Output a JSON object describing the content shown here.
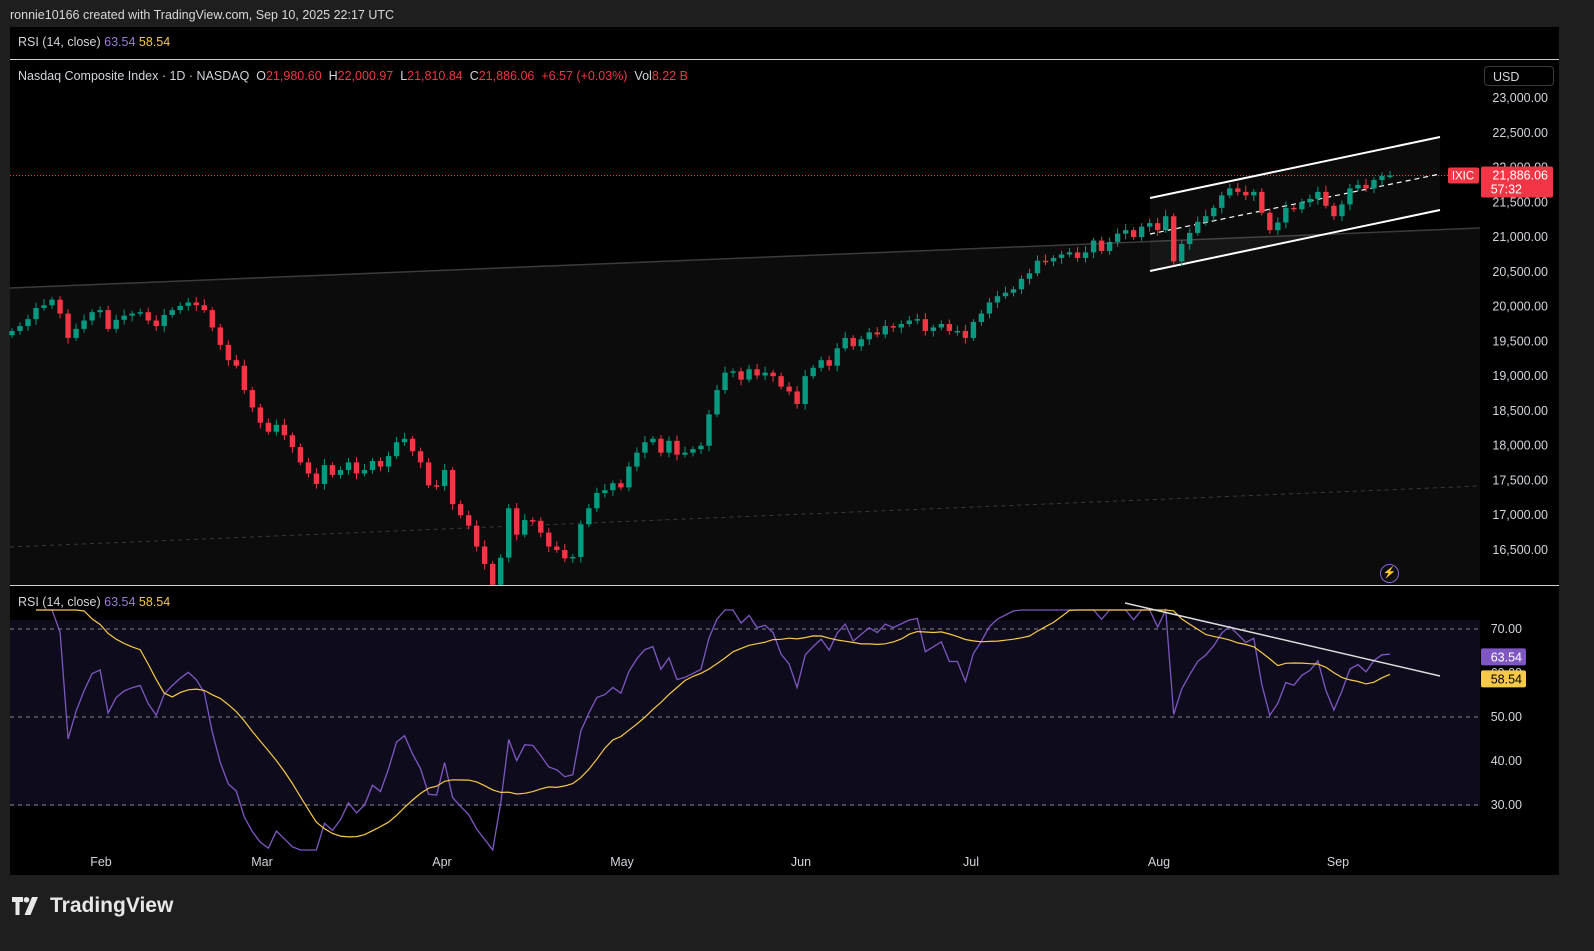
{
  "credit": "ronnie10166 created with TradingView.com, Sep 10, 2025 22:17 UTC",
  "top_indicator": {
    "label": "RSI (14, close)",
    "v1": "63.54",
    "v2": "58.54"
  },
  "header": {
    "symbol": "Nasdaq Composite Index · 1D · NASDAQ",
    "o_label": "O",
    "o": "21,980.60",
    "h_label": "H",
    "h": "22,000.97",
    "l_label": "L",
    "l": "21,810.84",
    "c_label": "C",
    "c": "21,886.06",
    "change": "+6.57 (+0.03%)",
    "vol_label": "Vol",
    "vol": "8.22 B"
  },
  "currency": "USD",
  "brand": "TradingView",
  "colors": {
    "up": "#089981",
    "down": "#f23645",
    "rsi": "#7e57c2",
    "rsi_ma": "#f7c948",
    "bg": "#000000"
  },
  "chart_data": [
    {
      "type": "candlestick",
      "title": "Nasdaq Composite Index · 1D · NASDAQ",
      "x_ticks": [
        "Feb",
        "Mar",
        "Apr",
        "May",
        "Jun",
        "Jul",
        "Aug",
        "Sep"
      ],
      "y_ticks": [
        "23,000.00",
        "22,500.00",
        "22,000.00",
        "21,500.00",
        "21,000.00",
        "20,500.00",
        "20,000.00",
        "19,500.00",
        "19,000.00",
        "18,500.00",
        "18,000.00",
        "17,500.00",
        "17,000.00",
        "16,500.00"
      ],
      "ylim": [
        16050,
        23250
      ],
      "last_price": {
        "symbol": "IXIC",
        "value": "21,886.06",
        "countdown": "57:32"
      },
      "closes": [
        19650,
        19720,
        19820,
        19980,
        20020,
        20100,
        19900,
        19550,
        19680,
        19800,
        19920,
        19950,
        19680,
        19810,
        19870,
        19900,
        19920,
        19800,
        19720,
        19880,
        19950,
        20010,
        20060,
        20020,
        19950,
        19700,
        19450,
        19230,
        19150,
        18800,
        18550,
        18330,
        18200,
        18300,
        18150,
        17980,
        17760,
        17600,
        17450,
        17720,
        17580,
        17650,
        17760,
        17600,
        17650,
        17780,
        17700,
        17850,
        18050,
        18100,
        17920,
        17760,
        17430,
        17420,
        17650,
        17160,
        17000,
        16850,
        16550,
        16300,
        16000,
        16390,
        17100,
        16720,
        16930,
        16920,
        16750,
        16550,
        16500,
        16380,
        16400,
        16870,
        17100,
        17320,
        17360,
        17460,
        17400,
        17700,
        17900,
        18050,
        18100,
        17900,
        18070,
        17870,
        17900,
        17950,
        18000,
        18450,
        18800,
        19050,
        19070,
        18950,
        19100,
        19010,
        19050,
        19000,
        18850,
        18780,
        18600,
        19000,
        19120,
        19230,
        19150,
        19400,
        19550,
        19430,
        19530,
        19630,
        19600,
        19720,
        19700,
        19750,
        19800,
        19820,
        19650,
        19700,
        19750,
        19650,
        19650,
        19550,
        19780,
        19900,
        20060,
        20150,
        20200,
        20250,
        20400,
        20480,
        20660,
        20650,
        20700,
        20750,
        20780,
        20700,
        20780,
        20950,
        20800,
        20930,
        21050,
        21100,
        21000,
        21150,
        21200,
        21100,
        21300,
        20650,
        20900,
        21060,
        21220,
        21300,
        21420,
        21600,
        21700,
        21650,
        21600,
        21650,
        21350,
        21100,
        21210,
        21420,
        21400,
        21500,
        21550,
        21650,
        21450,
        21300,
        21470,
        21700,
        21750,
        21700,
        21820,
        21880,
        21886
      ],
      "rsi": {
        "title": "RSI (14, close)",
        "value": "63.54",
        "ma_value": "58.54",
        "levels": [
          70,
          50,
          30
        ],
        "y_ticks": [
          "70.00",
          "60.00",
          "50.00",
          "40.00",
          "30.00"
        ],
        "ylim": [
          25,
          75
        ]
      }
    }
  ]
}
